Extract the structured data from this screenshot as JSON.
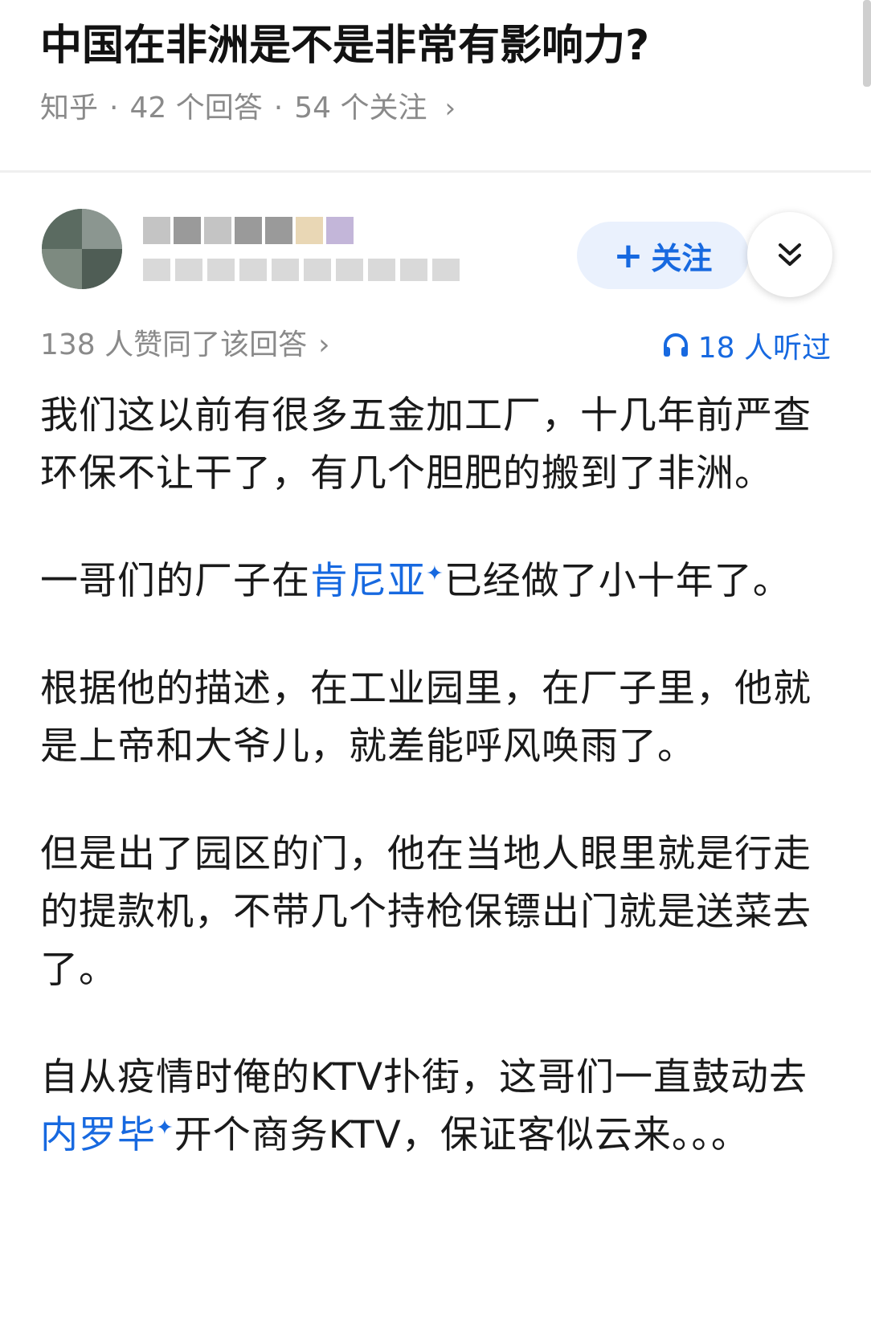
{
  "question": {
    "title": "中国在非洲是不是非常有影响力?",
    "site": "知乎",
    "answers": "42 个回答",
    "followers": "54 个关注"
  },
  "author": {
    "follow_label": "关注",
    "follow_icon": "plus-icon",
    "collapse_icon": "double-chevron-down-icon"
  },
  "stats": {
    "upvotes": "138 人赞同了该回答",
    "listens": "18 人听过",
    "listen_icon": "headphones-icon"
  },
  "answer": {
    "p1": "我们这以前有很多五金加工厂，十几年前严查环保不让干了，有几个胆肥的搬到了非洲。",
    "p2_before": "一哥们的厂子在",
    "p2_link": "肯尼亚",
    "p2_after": "已经做了小十年了。",
    "p3": "根据他的描述，在工业园里，在厂子里，他就是上帝和大爷儿，就差能呼风唤雨了。",
    "p4": "但是出了园区的门，他在当地人眼里就是行走的提款机，不带几个持枪保镖出门就是送菜去了。",
    "p5_before": "自从疫情时俺的KTV扑街，这哥们一直鼓动去",
    "p5_link": "内罗毕",
    "p5_after": "开个商务KTV，保证客似云来。。。"
  },
  "colors": {
    "accent": "#1769e0",
    "meta_gray": "#8a8a8a",
    "follow_bg": "#eaf1fd"
  }
}
